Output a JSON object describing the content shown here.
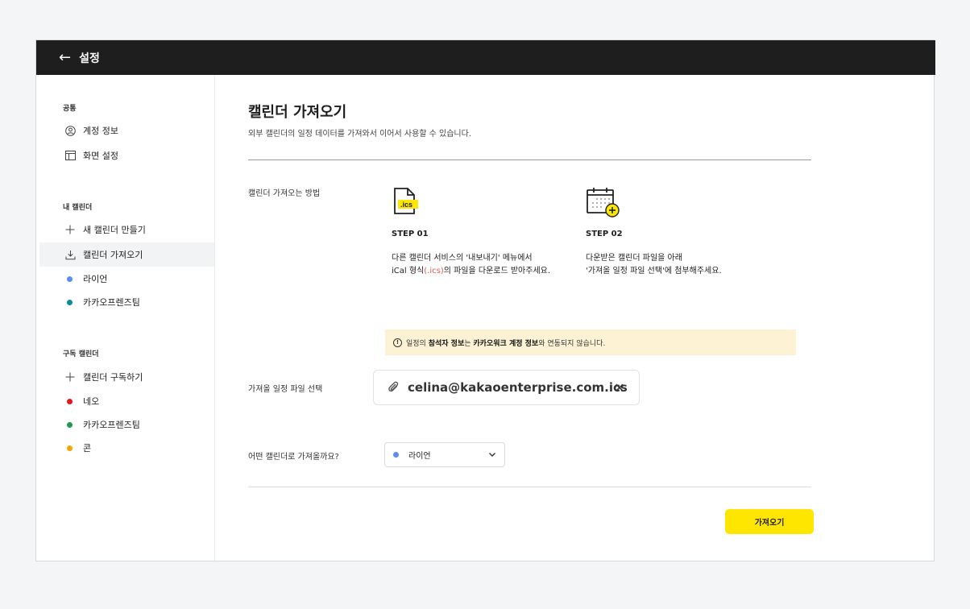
{
  "topbar": {
    "back_icon": "arrow-left-icon",
    "title": "설정"
  },
  "sidebar": {
    "common": {
      "title": "공통",
      "items": [
        {
          "label": "계정 정보",
          "icon": "user-circle-icon"
        },
        {
          "label": "화면 설정",
          "icon": "layout-icon"
        }
      ]
    },
    "my_calendars": {
      "title": "내 캘린더",
      "items": [
        {
          "label": "새 캘린더 만들기",
          "icon": "plus-icon"
        },
        {
          "label": "캘린더 가져오기",
          "icon": "download-icon",
          "active": true
        },
        {
          "label": "라이언",
          "color": "#5b8def"
        },
        {
          "label": "카카오프렌즈팀",
          "color": "#0e8a9a"
        }
      ]
    },
    "subscribed": {
      "title": "구독 캘린더",
      "items": [
        {
          "label": "캘린더 구독하기",
          "icon": "plus-icon"
        },
        {
          "label": "네오",
          "color": "#e8141b"
        },
        {
          "label": "카카오프렌즈팀",
          "color": "#1f9b4e"
        },
        {
          "label": "콘",
          "color": "#f5a300"
        }
      ]
    }
  },
  "main": {
    "title": "캘린더 가져오기",
    "description": "외부 캘린더의 일정 데이터를 가져와서 이어서 사용할 수 있습니다.",
    "method_label": "캘린더 가져오는 방법",
    "steps": [
      {
        "icon": "ics-file-icon",
        "icon_text": ".ics",
        "label": "STEP 01",
        "line1": "다른 캘린더 서비스의 '내보내기' 메뉴에서",
        "line2_pre": "iCal 형식",
        "line2_highlight": "(.ics)",
        "line2_post": "의 파일을 다운로드 받아주세요."
      },
      {
        "icon": "calendar-add-icon",
        "label": "STEP 02",
        "line1": "다운받은 캘린더 파일을 아래",
        "line2": "'가져올 일정 파일 선택'에 첨부해주세요."
      }
    ],
    "notice": {
      "icon": "info-icon",
      "part1": "일정의 ",
      "bold1": "참석자 정보",
      "part2": "는 ",
      "bold2": "카카오워크 계정 정보",
      "part3": "와 연동되지 않습니다."
    },
    "file_label": "가져올 일정 파일 선택",
    "file_name": "celina@kakaoenterprise.com.ics",
    "select_label": "어떤 캘린더로 가져올까요?",
    "select_value": "라이언",
    "select_color": "#5b8def",
    "submit_label": "가져오기"
  },
  "colors": {
    "accent": "#ffe600",
    "topbar": "#1e1e1e",
    "notice_bg": "#fdf3d4",
    "highlight": "#e5594a"
  }
}
